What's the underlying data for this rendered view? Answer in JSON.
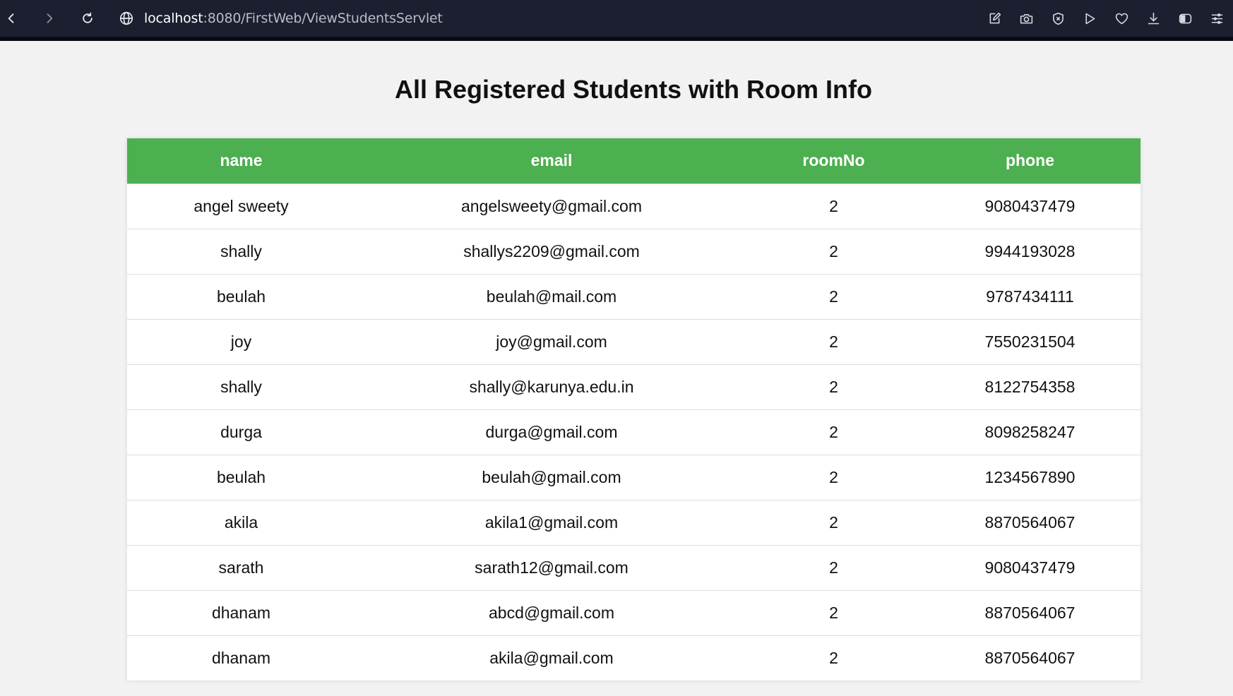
{
  "browser": {
    "url_host": "localhost",
    "url_rest": ":8080/FirstWeb/ViewStudentsServlet"
  },
  "page": {
    "title": "All Registered Students with Room Info"
  },
  "table": {
    "headers": [
      "name",
      "email",
      "roomNo",
      "phone"
    ],
    "rows": [
      [
        "angel sweety",
        "angelsweety@gmail.com",
        "2",
        "9080437479"
      ],
      [
        "shally",
        "shallys2209@gmail.com",
        "2",
        "9944193028"
      ],
      [
        "beulah",
        "beulah@mail.com",
        "2",
        "9787434111"
      ],
      [
        "joy",
        "joy@gmail.com",
        "2",
        "7550231504"
      ],
      [
        "shally",
        "shally@karunya.edu.in",
        "2",
        "8122754358"
      ],
      [
        "durga",
        "durga@gmail.com",
        "2",
        "8098258247"
      ],
      [
        "beulah",
        "beulah@gmail.com",
        "2",
        "1234567890"
      ],
      [
        "akila",
        "akila1@gmail.com",
        "2",
        "8870564067"
      ],
      [
        "sarath",
        "sarath12@gmail.com",
        "2",
        "9080437479"
      ],
      [
        "dhanam",
        "abcd@gmail.com",
        "2",
        "8870564067"
      ],
      [
        "dhanam",
        "akila@gmail.com",
        "2",
        "8870564067"
      ]
    ]
  },
  "colors": {
    "header_bg": "#4caf50",
    "chrome_bg": "#1c1f2f",
    "page_bg": "#f2f2f2"
  },
  "icons": [
    "back-icon",
    "forward-icon",
    "reload-icon",
    "globe-icon",
    "edit-icon",
    "camera-icon",
    "shield-icon",
    "play-icon",
    "heart-icon",
    "download-icon",
    "sidebar-icon",
    "menu-icon"
  ]
}
